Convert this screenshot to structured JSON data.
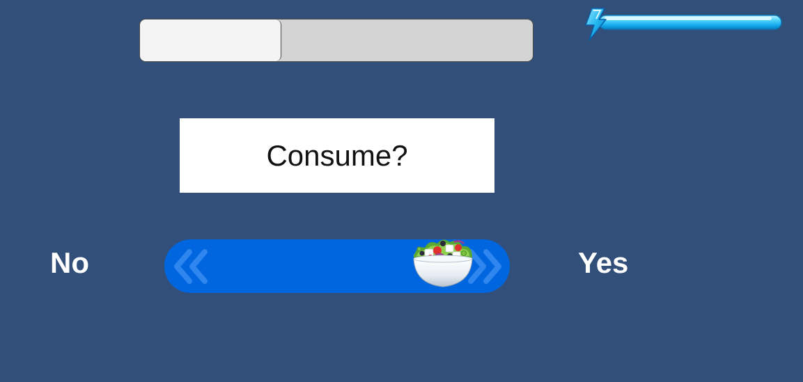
{
  "progress": {
    "fraction": 0.36
  },
  "energy": {
    "icon": "lightning-bolt-icon",
    "level": 1.0,
    "color": "#2fc4f4"
  },
  "prompt": {
    "text": "Consume?"
  },
  "choices": {
    "no_label": "No",
    "yes_label": "Yes"
  },
  "slider": {
    "handle_icon": "salad-bowl-icon",
    "track_color": "#0066e0",
    "position": 0.85
  },
  "colors": {
    "background": "#324f7a"
  }
}
